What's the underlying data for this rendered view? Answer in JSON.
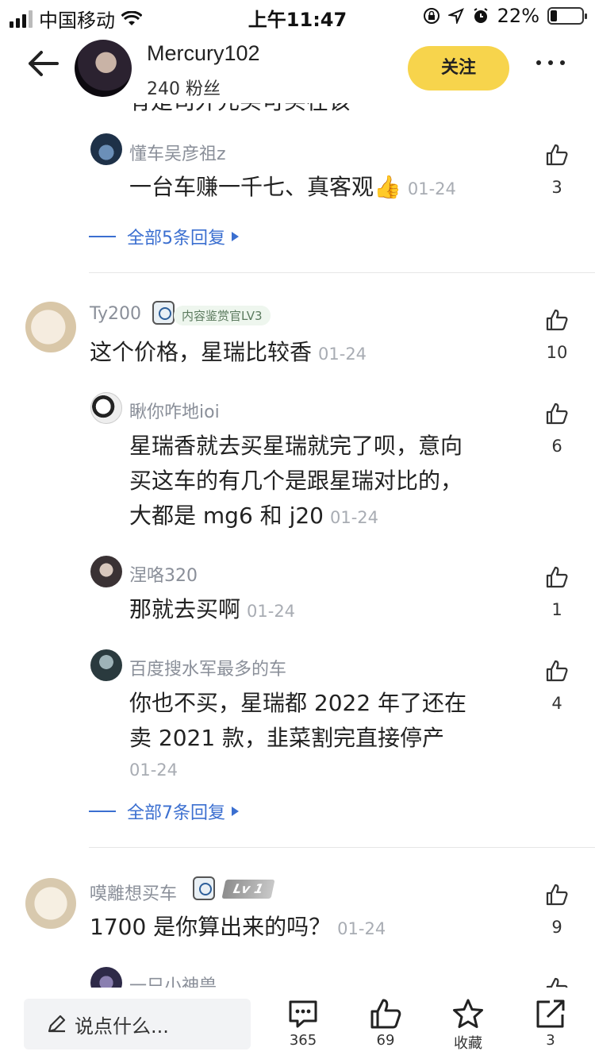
{
  "status_bar": {
    "carrier": "中国移动",
    "time": "上午11:47",
    "battery": "22%",
    "battery_level": 0.22
  },
  "header": {
    "name": "Mercury102",
    "fans": "240 粉丝",
    "follow_label": "关注"
  },
  "clipped_text": "有是司外元买可买在该",
  "thread1": {
    "reply": {
      "name": "懂车吴彦祖z",
      "text": "一台车赚一千七、真客观👍",
      "date": "01-24",
      "likes": "3"
    },
    "more_replies": "全部5条回复"
  },
  "comment2": {
    "name": "Ty200",
    "badge": "内容鉴赏官LV3",
    "text": "这个价格，星瑞比较香",
    "date": "01-24",
    "likes": "10",
    "replies": [
      {
        "name": "瞅你咋地ioi",
        "text_lines": [
          "星瑞香就去买星瑞就完了呗，意向",
          "买这车的有几个是跟星瑞对比的，",
          "大都是 mg6 和 j20"
        ],
        "date": "01-24",
        "likes": "6"
      },
      {
        "name": "涅咯320",
        "text": "那就去买啊",
        "date": "01-24",
        "likes": "1"
      },
      {
        "name": "百度搜水军最多的车",
        "text_lines": [
          "你也不买，星瑞都 2022 年了还在",
          "卖 2021 款，韭菜割完直接停产"
        ],
        "date": "01-24",
        "likes": "4"
      }
    ],
    "more_replies": "全部7条回复"
  },
  "comment3": {
    "name": "嗼離想买车",
    "level": "Lv 1",
    "text": "1700 是你算出来的吗？",
    "date": "01-24",
    "likes": "9",
    "next_reply_name": "一只小神兽"
  },
  "bottom_bar": {
    "input_placeholder": "说点什么...",
    "comments": "365",
    "likes": "69",
    "favorite": "收藏",
    "share": "3"
  }
}
